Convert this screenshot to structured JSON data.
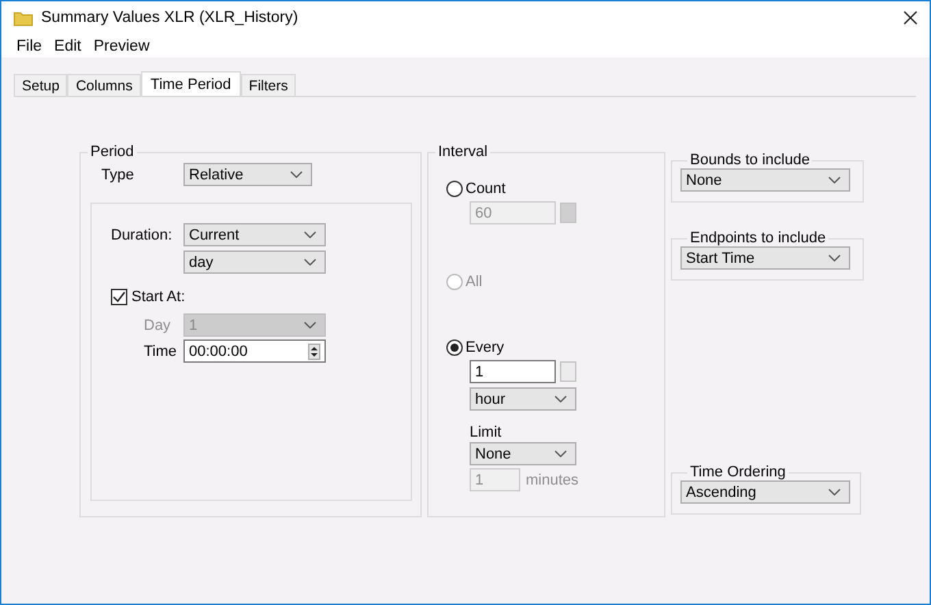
{
  "window": {
    "title": "Summary Values XLR (XLR_History)"
  },
  "menu": [
    "File",
    "Edit",
    "Preview"
  ],
  "tabs": [
    {
      "label": "Setup",
      "selected": false
    },
    {
      "label": "Columns",
      "selected": false
    },
    {
      "label": "Time Period",
      "selected": true
    },
    {
      "label": "Filters",
      "selected": false
    }
  ],
  "period": {
    "title": "Period",
    "type_label": "Type",
    "type_value": "Relative",
    "duration_label": "Duration:",
    "duration_value": "Current",
    "duration_unit": "day",
    "start_at": {
      "label": "Start At:",
      "checked": true
    },
    "day": {
      "label": "Day",
      "value": "1",
      "disabled": true
    },
    "time": {
      "label": "Time",
      "value": "00:00:00"
    }
  },
  "interval": {
    "title": "Interval",
    "options": [
      {
        "label": "Count",
        "selected": false,
        "disabled": false,
        "field": {
          "value": "60",
          "disabled": true
        }
      },
      {
        "label": "All",
        "selected": false,
        "disabled": true
      },
      {
        "label": "Every",
        "selected": true,
        "disabled": false,
        "field": {
          "value": "1",
          "disabled": false
        },
        "unit": "hour"
      }
    ],
    "limit": {
      "label": "Limit",
      "value": "None",
      "count": {
        "value": "1",
        "disabled": true
      },
      "unit": "minutes"
    }
  },
  "bounds": {
    "title": "Bounds to include",
    "value": "None"
  },
  "endpoints": {
    "title": "Endpoints to include",
    "value": "Start Time"
  },
  "time_ordering": {
    "title": "Time Ordering",
    "value": "Ascending"
  }
}
